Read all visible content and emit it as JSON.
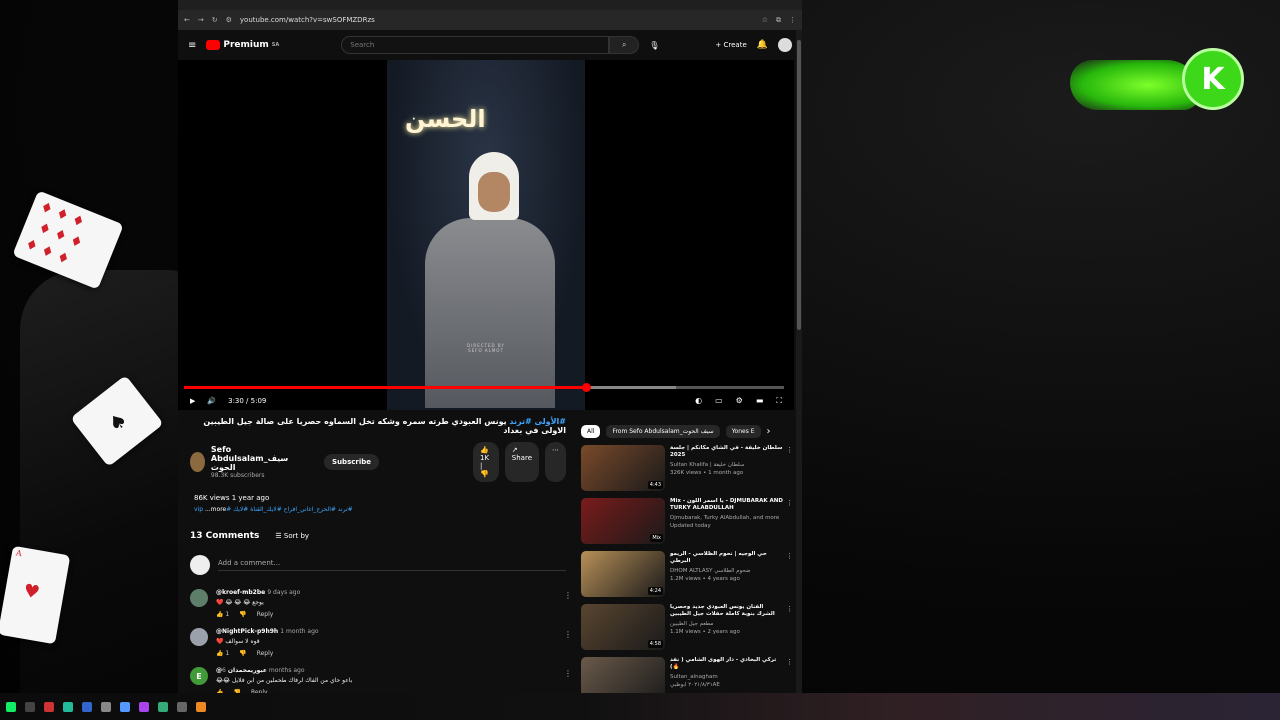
{
  "browser": {
    "url": "youtube.com/watch?v=swSOFMZDRzs"
  },
  "youtube": {
    "logo_text": "Premium",
    "logo_sup": "SA",
    "search_placeholder": "Search",
    "create_label": "Create"
  },
  "player": {
    "sign_text": "الحسن",
    "credit_line1": "DIRECTED BY",
    "credit_line2": "SEFO ALMOT",
    "time": "3:30 / 5:09",
    "progress_fraction": 0.67,
    "buffer_fraction": 0.82
  },
  "video": {
    "title_hashtags": "#الأولى #ترند",
    "title_text": "يونس العبودي طرته سمره وشكه تخل السماوه حصريا على صالة جيل الطيبين الاولى في بغداد",
    "channel_name": "Sefo Abdulsalam_سيف الحوت",
    "subscribers": "98.3K subscribers",
    "subscribe_label": "Subscribe",
    "likes": "1K",
    "share_label": "Share",
    "views_date": "86K views  1 year ago",
    "tags": "#ترند #الحرج_اغاني_افراح #لايك_القناة #لايك #vip",
    "more_label": "...more"
  },
  "comments": {
    "count_label": "13 Comments",
    "sort_label": "Sort by",
    "add_placeholder": "Add a comment...",
    "reply_label": "Reply",
    "items": [
      {
        "author": "@kroef-mb2be",
        "time": "9 days ago",
        "text": "❤️ 😂 😂 😂 يوجع",
        "likes": "1",
        "color": "#5d7f6a"
      },
      {
        "author": "@NightPick-p9h9h",
        "time": "1 month ago",
        "text": "❤️ قوه لا سوالف",
        "likes": "1",
        "color": "#9aa1ab"
      },
      {
        "author": "@عبوريمحمدان",
        "time": "6 months ago",
        "text": "😂😂 باعو حاي من الفاك لرفاك طحملين من ابن فلايل",
        "likes": "",
        "color": "#3f9a37",
        "initial": "E"
      }
    ]
  },
  "sidebar": {
    "chips": [
      "All",
      "From Sefo Abdulsalam_سيف الحوت",
      "Yones E"
    ],
    "recommendations": [
      {
        "title": "سلطان خليفة - في الشاي مكانكم | جلسة 2025",
        "channel": "Sultan Khalifa | سلطان خليفة",
        "meta": "326K views • 1 month ago",
        "duration": "4:43",
        "color": "#7a4a2a"
      },
      {
        "title": "Mix - يا اسمر اللون - DJMUBARAK AND TURKY ALABDULLAH",
        "channel": "Djmubarak, Turky AlAbdullah, and more",
        "meta": "Updated today",
        "duration": "Mix",
        "color": "#7b1b1b"
      },
      {
        "title": "حي الوجيه | نحوم الظلاسي - الريمو البرطي",
        "channel": "DHOM ALTLASY ضحوم الطلاسي",
        "meta": "1.2M views • 4 years ago",
        "duration": "4:24",
        "color": "#b89058"
      },
      {
        "title": "الفنان يونس العبودي جديد وحصريا الشرك بنوبة كاملة حفلات جيل الطيبين",
        "channel": "مطعم جيل الطيبين",
        "meta": "1.1M views • 2 years ago",
        "duration": "4:58",
        "color": "#5a4630"
      },
      {
        "title": "تركي البخادي - دار الهوى الشامي ( نفد 🔥)",
        "channel": "Sultan_alnagham",
        "meta": "٢٠٢١/٨/٣١ ابوظبيAE",
        "duration": "",
        "color": "#6a5a4a"
      }
    ]
  }
}
